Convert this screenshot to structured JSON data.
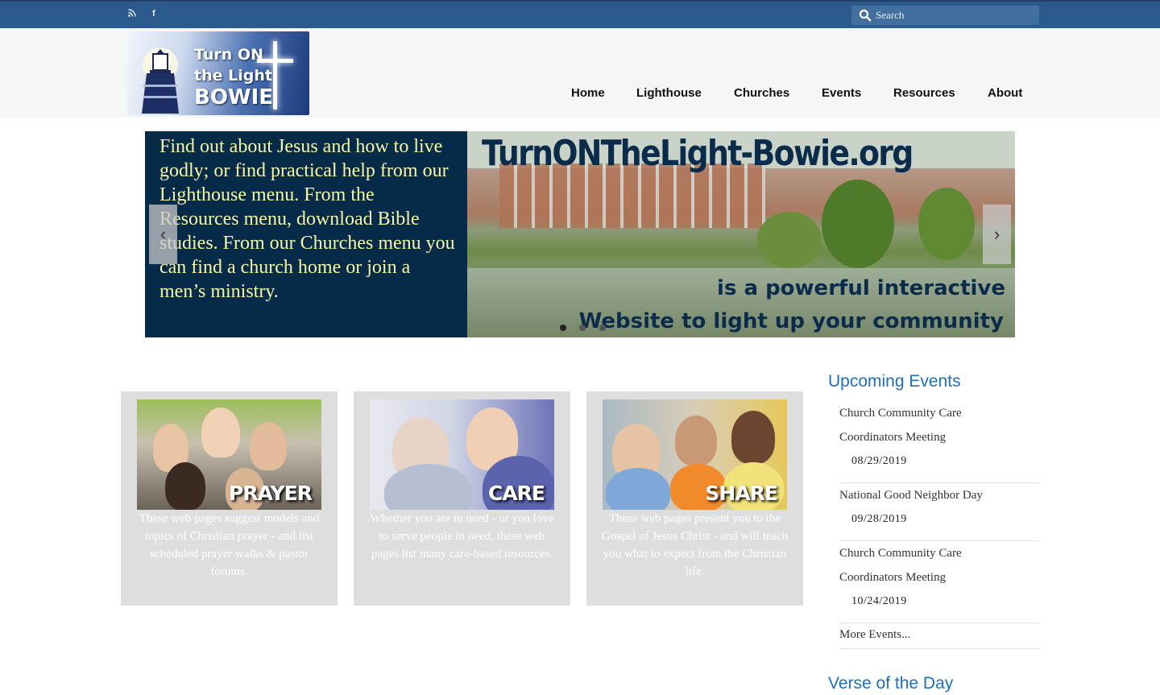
{
  "topbar": {
    "rss_glyph": "))",
    "facebook_glyph": "f",
    "search_placeholder": "Search"
  },
  "logo": {
    "line1": "Turn ON",
    "line2": "the Light",
    "line3": "BOWIE"
  },
  "nav": {
    "items": [
      {
        "label": "Home"
      },
      {
        "label": "Lighthouse"
      },
      {
        "label": "Churches"
      },
      {
        "label": "Events"
      },
      {
        "label": "Resources"
      },
      {
        "label": "About"
      }
    ]
  },
  "slider": {
    "left_text": "Find out about Jesus and how to live godly; or find practical help from our Lighthouse menu. From the Resources menu, download Bible studies. From our Churches menu you can find a church home or join a men’s ministry.",
    "title": "TurnONTheLight-Bowie.org",
    "subtitle1": "is a powerful interactive",
    "subtitle2": "Website to light up your community",
    "prev_glyph": "‹",
    "next_glyph": "›",
    "dot_count": 3,
    "active_dot": 0
  },
  "cards": [
    {
      "label": "PRAYER",
      "desc": "These web pages suggest models and topics of Christian prayer - and list scheduled prayer walks & pastor forums."
    },
    {
      "label": "CARE",
      "desc": "Whether you are in need - or you love to serve people in need, these web pages list many care-based resources."
    },
    {
      "label": "SHARE",
      "desc": "These web pages present you to the Gospel of Jesus Christ - and will teach you what to expect from the Christian life."
    }
  ],
  "sidebar": {
    "events_title": "Upcoming Events",
    "events": [
      {
        "name": "Church Community Care Coordinators Meeting",
        "date": "08/29/2019"
      },
      {
        "name": "National Good Neighbor Day",
        "date": "09/28/2019"
      },
      {
        "name": "Church Community Care Coordinators Meeting",
        "date": "10/24/2019"
      }
    ],
    "more_label": "More Events...",
    "verse_title": "Verse of the Day"
  },
  "colors": {
    "topbar": "#2b5a8c",
    "slide_panel": "#062b48",
    "slide_text": "#f7f5a8",
    "accent_title": "#1f6fbf"
  }
}
